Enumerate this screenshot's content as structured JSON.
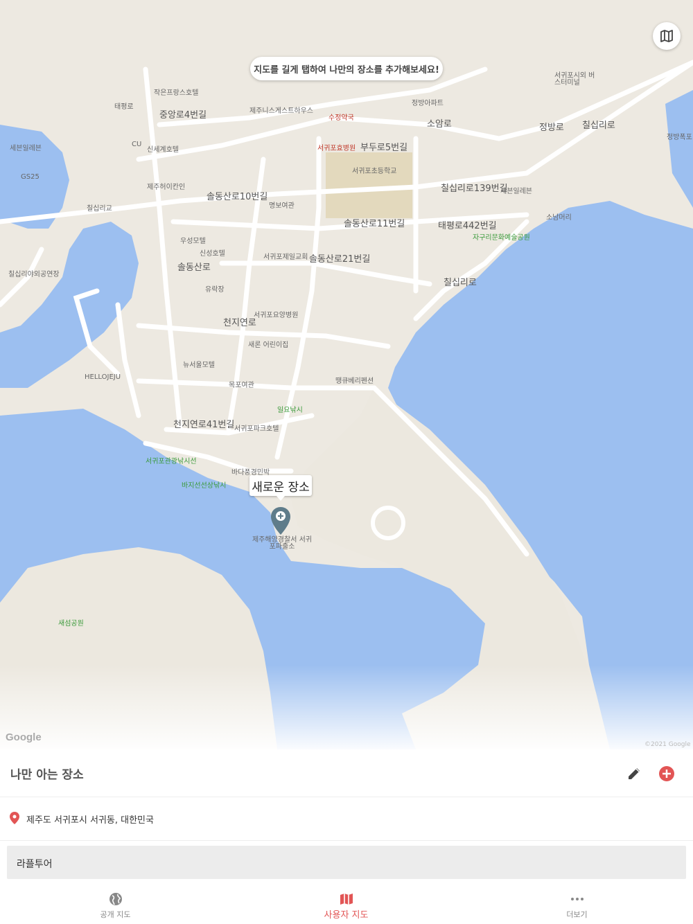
{
  "map": {
    "hint": "지도를 길게 탭하여 나만의 장소를 추가해보세요!",
    "pin_label": "새로운 장소",
    "watermark": "Google",
    "copyright": "©2021 Google",
    "labels": [
      "세븐일레븐",
      "GS25",
      "CU",
      "칠십리교",
      "칠십리야외공연장",
      "태평로",
      "신세계호텔",
      "제주허이칸인",
      "중앙로4번길",
      "작은프랑스호텔",
      "제주니스게스트하우스",
      "수정약국",
      "서귀포효병원",
      "부두로5번길",
      "서귀포초등학교",
      "소암로",
      "정방아파트",
      "서귀포시외 버스터미널",
      "솔동산로10번길",
      "명보여관",
      "솔동산로11번길",
      "칠십리로139번길",
      "세븐일레븐",
      "소남머리",
      "자구리문화예술공원",
      "우성모텔",
      "신성호텔",
      "서귀포제일교회",
      "솔동산로21번길",
      "유락장",
      "서귀포요양병원",
      "천지연로",
      "새론 어린이집",
      "뉴서울모텔",
      "HELLOJEJU",
      "목포여관",
      "땡큐베리펜션",
      "일요낚시",
      "서귀포파크호텔",
      "천지연로41번길",
      "서귀포관광낚시선",
      "바다풍경민박",
      "바지선선상낚시",
      "제주해양경찰서 서귀포파출소",
      "새섬공원",
      "칠십리로",
      "정방로",
      "정방폭포",
      "태평로442번길",
      "솔동산로",
      "칠십리로"
    ]
  },
  "place": {
    "title": "나만 아는 장소",
    "address": "제주도 서귀포시 서귀동, 대한민국",
    "memo": "라플투어"
  },
  "tabs": [
    {
      "label": "공개 지도",
      "icon": "globe-icon",
      "active": false
    },
    {
      "label": "사용자 지도",
      "icon": "map-icon",
      "active": true
    },
    {
      "label": "더보기",
      "icon": "more-icon",
      "active": false
    }
  ],
  "colors": {
    "water": "#9cbff0",
    "land": "#ede9e1",
    "accent": "#e25555",
    "pin": "#5f7c8a"
  }
}
